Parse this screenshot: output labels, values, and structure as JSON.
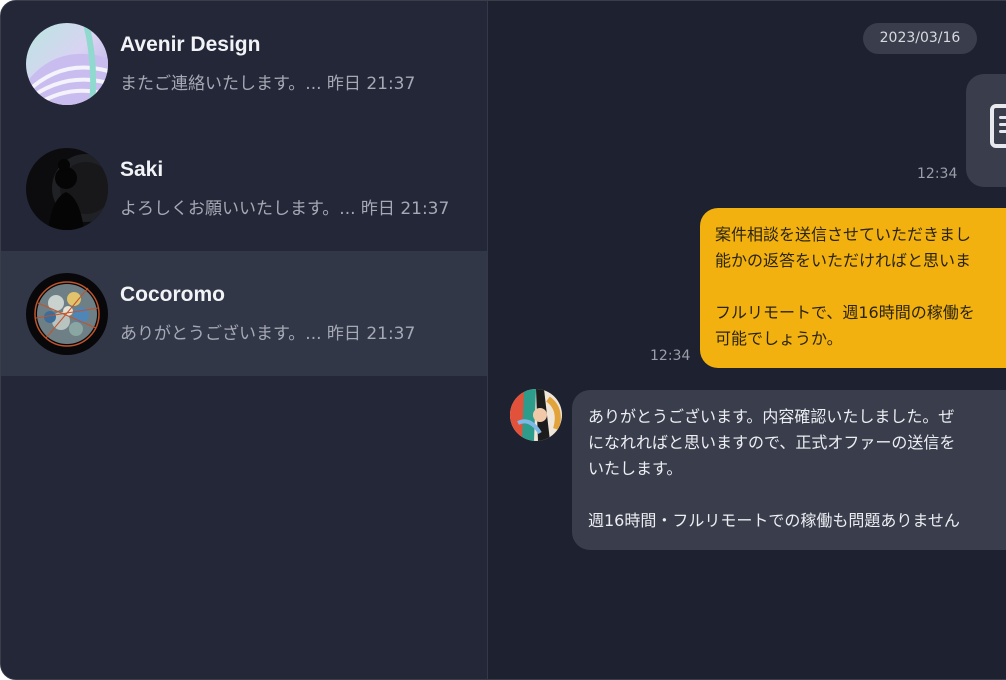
{
  "conversations": [
    {
      "name": "Avenir Design",
      "preview": "またご連絡いたします。... 昨日 21:37",
      "active": false
    },
    {
      "name": "Saki",
      "preview": "よろしくお願いいたします。... 昨日 21:37",
      "active": false
    },
    {
      "name": "Cocoromo",
      "preview": "ありがとうございます。... 昨日 21:37",
      "active": true
    }
  ],
  "chat": {
    "date": "2023/03/16",
    "file_message": {
      "time": "12:34",
      "icon": "document-icon"
    },
    "outgoing": {
      "time": "12:34",
      "lines": [
        "案件相談を送信させていただきまし",
        "能かの返答をいただければと思いま",
        "",
        "フルリモートで、週16時間の稼働を",
        "可能でしょうか。"
      ]
    },
    "incoming": {
      "lines": [
        "ありがとうございます。内容確認いたしました。ぜ",
        "になれればと思いますので、正式オファーの送信を",
        "いたします。",
        "",
        "週16時間・フルリモートでの稼働も問題ありません"
      ]
    }
  },
  "colors": {
    "sidebar_bg": "#232737",
    "active_bg": "#323748",
    "chat_bg": "#1e2130",
    "outgoing_bubble": "#f2b10f",
    "incoming_bubble": "#393d4c"
  }
}
